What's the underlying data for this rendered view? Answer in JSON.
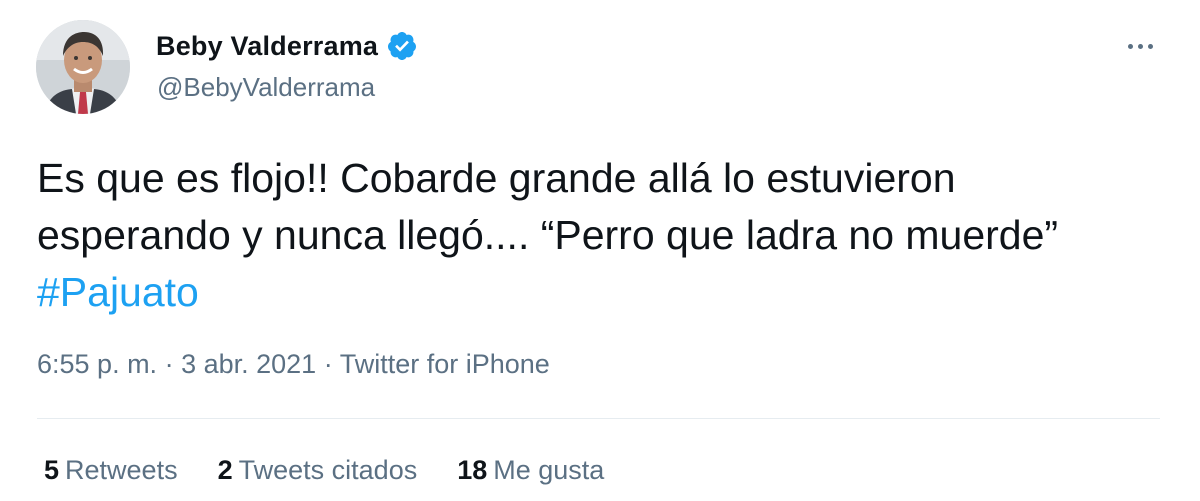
{
  "author": {
    "display_name": "Beby Valderrama",
    "handle": "@BebyValderrama",
    "verified_icon": "verified-badge-icon",
    "avatar_icon": "profile-photo"
  },
  "menu": {
    "icon": "more-options-icon"
  },
  "tweet": {
    "line1": "Es que es flojo!! Cobarde grande allá lo estuvieron",
    "line2": "esperando y nunca llegó.... “Perro que ladra no muerde”",
    "hashtag": "#Pajuato"
  },
  "meta": {
    "time": "6:55 p. m.",
    "sep1": " · ",
    "date": "3 abr. 2021",
    "sep2": " · ",
    "source": "Twitter for iPhone"
  },
  "stats": [
    {
      "count": "5",
      "label": "Retweets"
    },
    {
      "count": "2",
      "label": "Tweets citados"
    },
    {
      "count": "18",
      "label": "Me gusta"
    }
  ],
  "colors": {
    "accent": "#1da1f2",
    "muted": "#5b7083",
    "text": "#0f1419"
  }
}
